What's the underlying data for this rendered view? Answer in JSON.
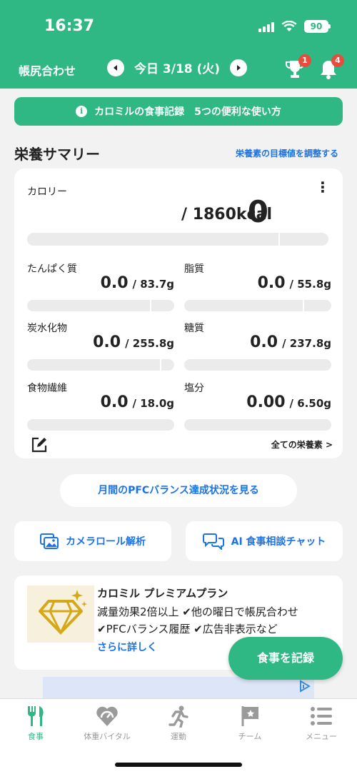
{
  "status_bar": {
    "time": "16:37",
    "battery": "90"
  },
  "nav": {
    "title": "帳尻合わせ",
    "date": "今日 3/18 (火)",
    "trophy_badge": "1",
    "bell_badge": "4"
  },
  "info_banner": "カロミルの食事記録　5つの便利な使い方",
  "summary": {
    "title": "栄養サマリー",
    "adjust_link": "栄養素の目標値を調整する",
    "calorie": {
      "label": "カロリー",
      "value": "0",
      "target": "/ 1860kcal",
      "progress": 0
    },
    "nutrients": [
      {
        "label": "たんぱく質",
        "value": "0.0",
        "target": "/ 83.7g",
        "progress": 0
      },
      {
        "label": "脂質",
        "value": "0.0",
        "target": "/ 55.8g",
        "progress": 0
      },
      {
        "label": "炭水化物",
        "value": "0.0",
        "target": "/ 255.8g",
        "progress": 0
      },
      {
        "label": "糖質",
        "value": "0.0",
        "target": "/ 237.8g",
        "progress": 0
      },
      {
        "label": "食物繊維",
        "value": "0.0",
        "target": "/ 18.0g",
        "progress": 0
      },
      {
        "label": "塩分",
        "value": "0.00",
        "target": "/ 6.50g",
        "progress": 0
      }
    ],
    "all_nutrients_link": "全ての栄養素 >"
  },
  "pfc_button": "月間のPFCバランス達成状況を見る",
  "camera_roll_button": "カメラロール解析",
  "ai_chat_button": "AI 食事相談チャット",
  "premium": {
    "title": "カロミル プレミアムプラン",
    "line1": "減量効果2倍以上 ✔他の曜日で帳尻合わせ",
    "line2": "✔PFCバランス履歴 ✔広告非表示など",
    "more": "さらに詳しく"
  },
  "record_button": "食事を記録",
  "tabs": [
    {
      "label": "食事",
      "icon": "fork-knife-icon",
      "active": true
    },
    {
      "label": "体重バイタル",
      "icon": "heart-scale-icon",
      "active": false
    },
    {
      "label": "運動",
      "icon": "running-icon",
      "active": false
    },
    {
      "label": "チーム",
      "icon": "team-flag-icon",
      "active": false
    },
    {
      "label": "メニュー",
      "icon": "menu-list-icon",
      "active": false
    }
  ],
  "colors": {
    "brand_green": "#2fb784",
    "link_blue": "#1a73e8",
    "badge_red": "#e74c3c"
  }
}
